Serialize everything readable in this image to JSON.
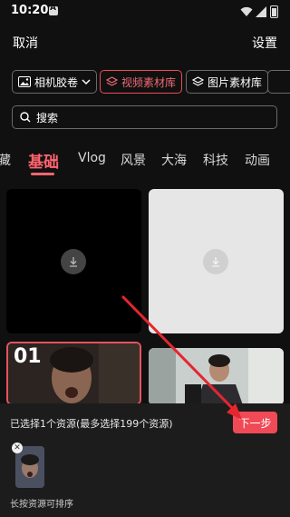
{
  "status": {
    "time": "10:20"
  },
  "topbar": {
    "cancel_label": "取消",
    "settings_label": "设置"
  },
  "source_tabs": [
    {
      "label": "相机胶卷",
      "icon": "image-icon",
      "has_dropdown": true
    },
    {
      "label": "视频素材库",
      "icon": "layers-icon",
      "active": true
    },
    {
      "label": "图片素材库",
      "icon": "layers-icon"
    }
  ],
  "search": {
    "placeholder": "搜索"
  },
  "categories": [
    "藏",
    "基础",
    "Vlog",
    "风景",
    "大海",
    "科技",
    "动画"
  ],
  "active_category": "基础",
  "grid": {
    "selected_index_label": "01"
  },
  "bottom": {
    "selection_text": "已选择1个资源(最多选择199个资源)",
    "next_label": "下一步",
    "hint": "长按资源可排序",
    "close_glyph": "✕"
  },
  "colors": {
    "accent": "#f04a56",
    "background": "#101010",
    "panel": "#1c1c1c"
  }
}
